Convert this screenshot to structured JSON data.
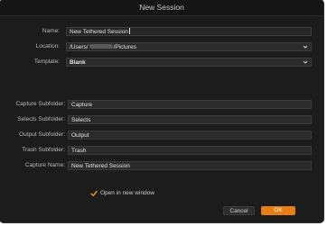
{
  "window": {
    "title": "New Session"
  },
  "form": {
    "name": {
      "label": "Name:",
      "value": "New Tethered Session"
    },
    "location": {
      "label": "Location:",
      "value_prefix": "/Users/",
      "value_suffix": "/Pictures"
    },
    "template": {
      "label": "Template:",
      "value": "Blank"
    },
    "capture_subfolder": {
      "label": "Capture Subfolder:",
      "value": "Capture"
    },
    "selects_subfolder": {
      "label": "Selects Subfolder:",
      "value": "Selects"
    },
    "output_subfolder": {
      "label": "Output Subfolder:",
      "value": "Output"
    },
    "trash_subfolder": {
      "label": "Trash Subfolder:",
      "value": "Trash"
    },
    "capture_name": {
      "label": "Capture Name:",
      "value": "New Tethered Session"
    }
  },
  "options": {
    "open_in_new_window": {
      "label": "Open in new window",
      "checked": true
    }
  },
  "buttons": {
    "cancel": "Cancel",
    "ok": "OK"
  },
  "colors": {
    "accent": "#e67e12",
    "background": "#1c1c1c",
    "field": "#2b2b2b"
  },
  "icons": {
    "checkmark": "checkmark-icon",
    "dropdown": "chevron-down-icon"
  }
}
